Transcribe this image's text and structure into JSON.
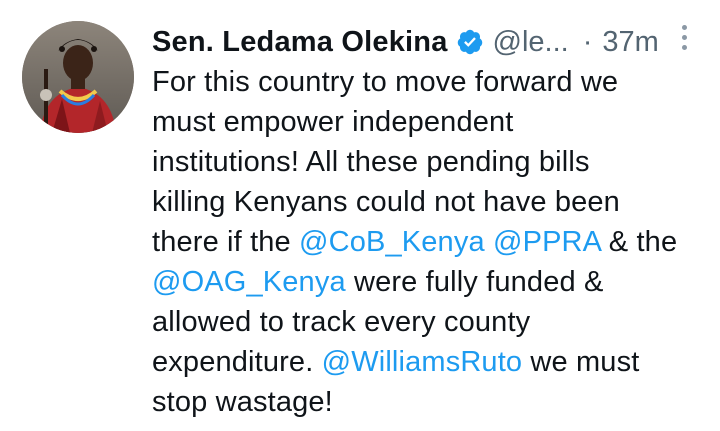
{
  "tweet": {
    "author_name": "Sen. Ledama Olekina",
    "handle": "@le...",
    "separator": "·",
    "time": "37m",
    "verified_color": "#1d9bf0",
    "mention_color": "#1d9bf0",
    "lines": [
      [
        {
          "text": "For this country to move forward we"
        }
      ],
      [
        {
          "text": "must empower independent"
        }
      ],
      [
        {
          "text": "institutions! All these pending bills"
        }
      ],
      [
        {
          "text": "killing Kenyans could not have been"
        }
      ],
      [
        {
          "text": "there if the "
        },
        {
          "text": "@CoB_Kenya",
          "mention": true
        },
        {
          "text": " "
        },
        {
          "text": "@PPRA",
          "mention": true
        },
        {
          "text": " & the"
        }
      ],
      [
        {
          "text": "@OAG_Kenya",
          "mention": true
        },
        {
          "text": " were fully funded &"
        }
      ],
      [
        {
          "text": "allowed to track every county"
        }
      ],
      [
        {
          "text": "expenditure. "
        },
        {
          "text": "@WilliamsRuto",
          "mention": true
        },
        {
          "text": " we must"
        }
      ],
      [
        {
          "text": "stop wastage!"
        }
      ]
    ],
    "icons": {
      "avatar": "profile-photo",
      "verified": "verified-badge-icon",
      "more": "more-vertical-icon"
    }
  }
}
